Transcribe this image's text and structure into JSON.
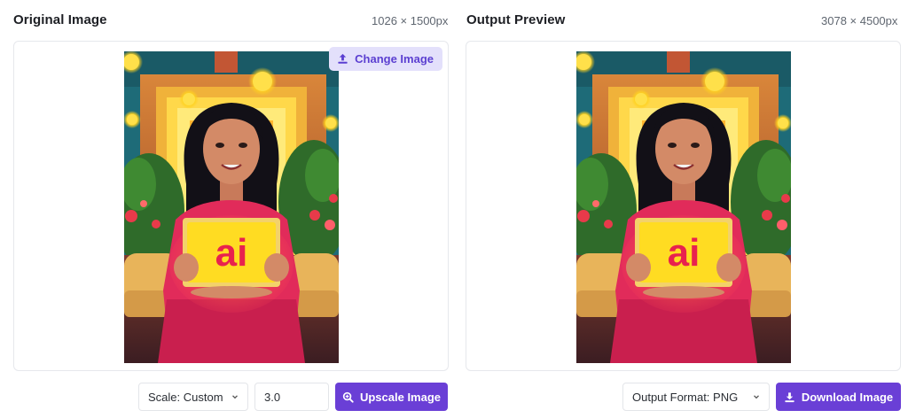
{
  "original": {
    "title": "Original Image",
    "dimensions": "1026 × 1500px",
    "change_label": "Change Image",
    "image_text": "ai"
  },
  "output": {
    "title": "Output Preview",
    "dimensions": "3078 × 4500px",
    "image_text": "ai"
  },
  "controls": {
    "scale_label": "Scale: Custom",
    "scale_value": "3.0",
    "upscale_label": "Upscale Image",
    "format_label": "Output Format: PNG",
    "download_label": "Download Image"
  },
  "icons": {
    "upload": "upload-icon",
    "zoom": "zoom-in-icon",
    "download": "download-icon",
    "chevron": "chevron-down-icon"
  },
  "colors": {
    "accent": "#6a3fd6",
    "accent_soft": "#e3e0fb",
    "accent_text": "#5b3fd1"
  }
}
